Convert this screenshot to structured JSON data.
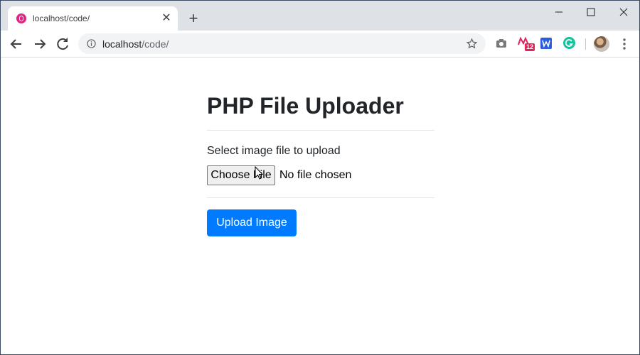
{
  "browser": {
    "tab": {
      "title": "localhost/code/",
      "close_glyph": "✕",
      "favicon": "app-favicon-icon"
    },
    "new_tab_glyph": "+",
    "address": {
      "host": "localhost",
      "path": "/code/"
    },
    "extensions": [
      {
        "name": "camera-extension-icon"
      },
      {
        "name": "m-extension-icon",
        "badge": "12"
      },
      {
        "name": "w-extension-icon"
      },
      {
        "name": "grammarly-extension-icon"
      }
    ],
    "colors": {
      "tabstrip": "#dee1e6",
      "omnibox": "#f1f3f4"
    }
  },
  "page": {
    "title": "PHP File Uploader",
    "field_label": "Select image file to upload",
    "choose_file_label": "Choose File",
    "file_status": "No file chosen",
    "upload_button_label": "Upload Image",
    "colors": {
      "primary": "#007bff",
      "text": "#212529"
    }
  }
}
